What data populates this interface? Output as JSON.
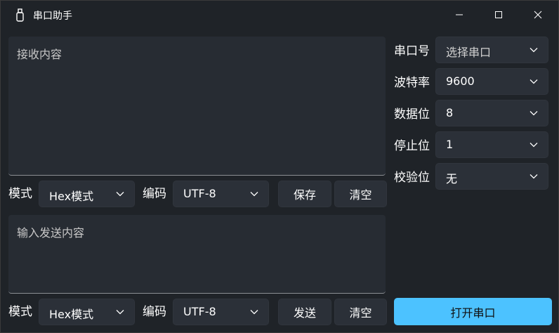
{
  "window": {
    "title": "串口助手"
  },
  "receive": {
    "placeholder": "接收内容"
  },
  "receive_controls": {
    "mode_label": "模式",
    "mode_value": "Hex模式",
    "encoding_label": "编码",
    "encoding_value": "UTF-8",
    "save_label": "保存",
    "clear_label": "清空"
  },
  "send": {
    "placeholder": "输入发送内容"
  },
  "send_controls": {
    "mode_label": "模式",
    "mode_value": "Hex模式",
    "encoding_label": "编码",
    "encoding_value": "UTF-8",
    "send_label": "发送",
    "clear_label": "清空"
  },
  "settings": {
    "port_label": "串口号",
    "port_value": "选择串口",
    "baud_label": "波特率",
    "baud_value": "9600",
    "databits_label": "数据位",
    "databits_value": "8",
    "stopbits_label": "停止位",
    "stopbits_value": "1",
    "parity_label": "校验位",
    "parity_value": "无"
  },
  "open_port": {
    "label": "打开串口"
  },
  "colors": {
    "accent": "#4cc2ff",
    "background": "#1f2328",
    "panel": "#272c33"
  }
}
